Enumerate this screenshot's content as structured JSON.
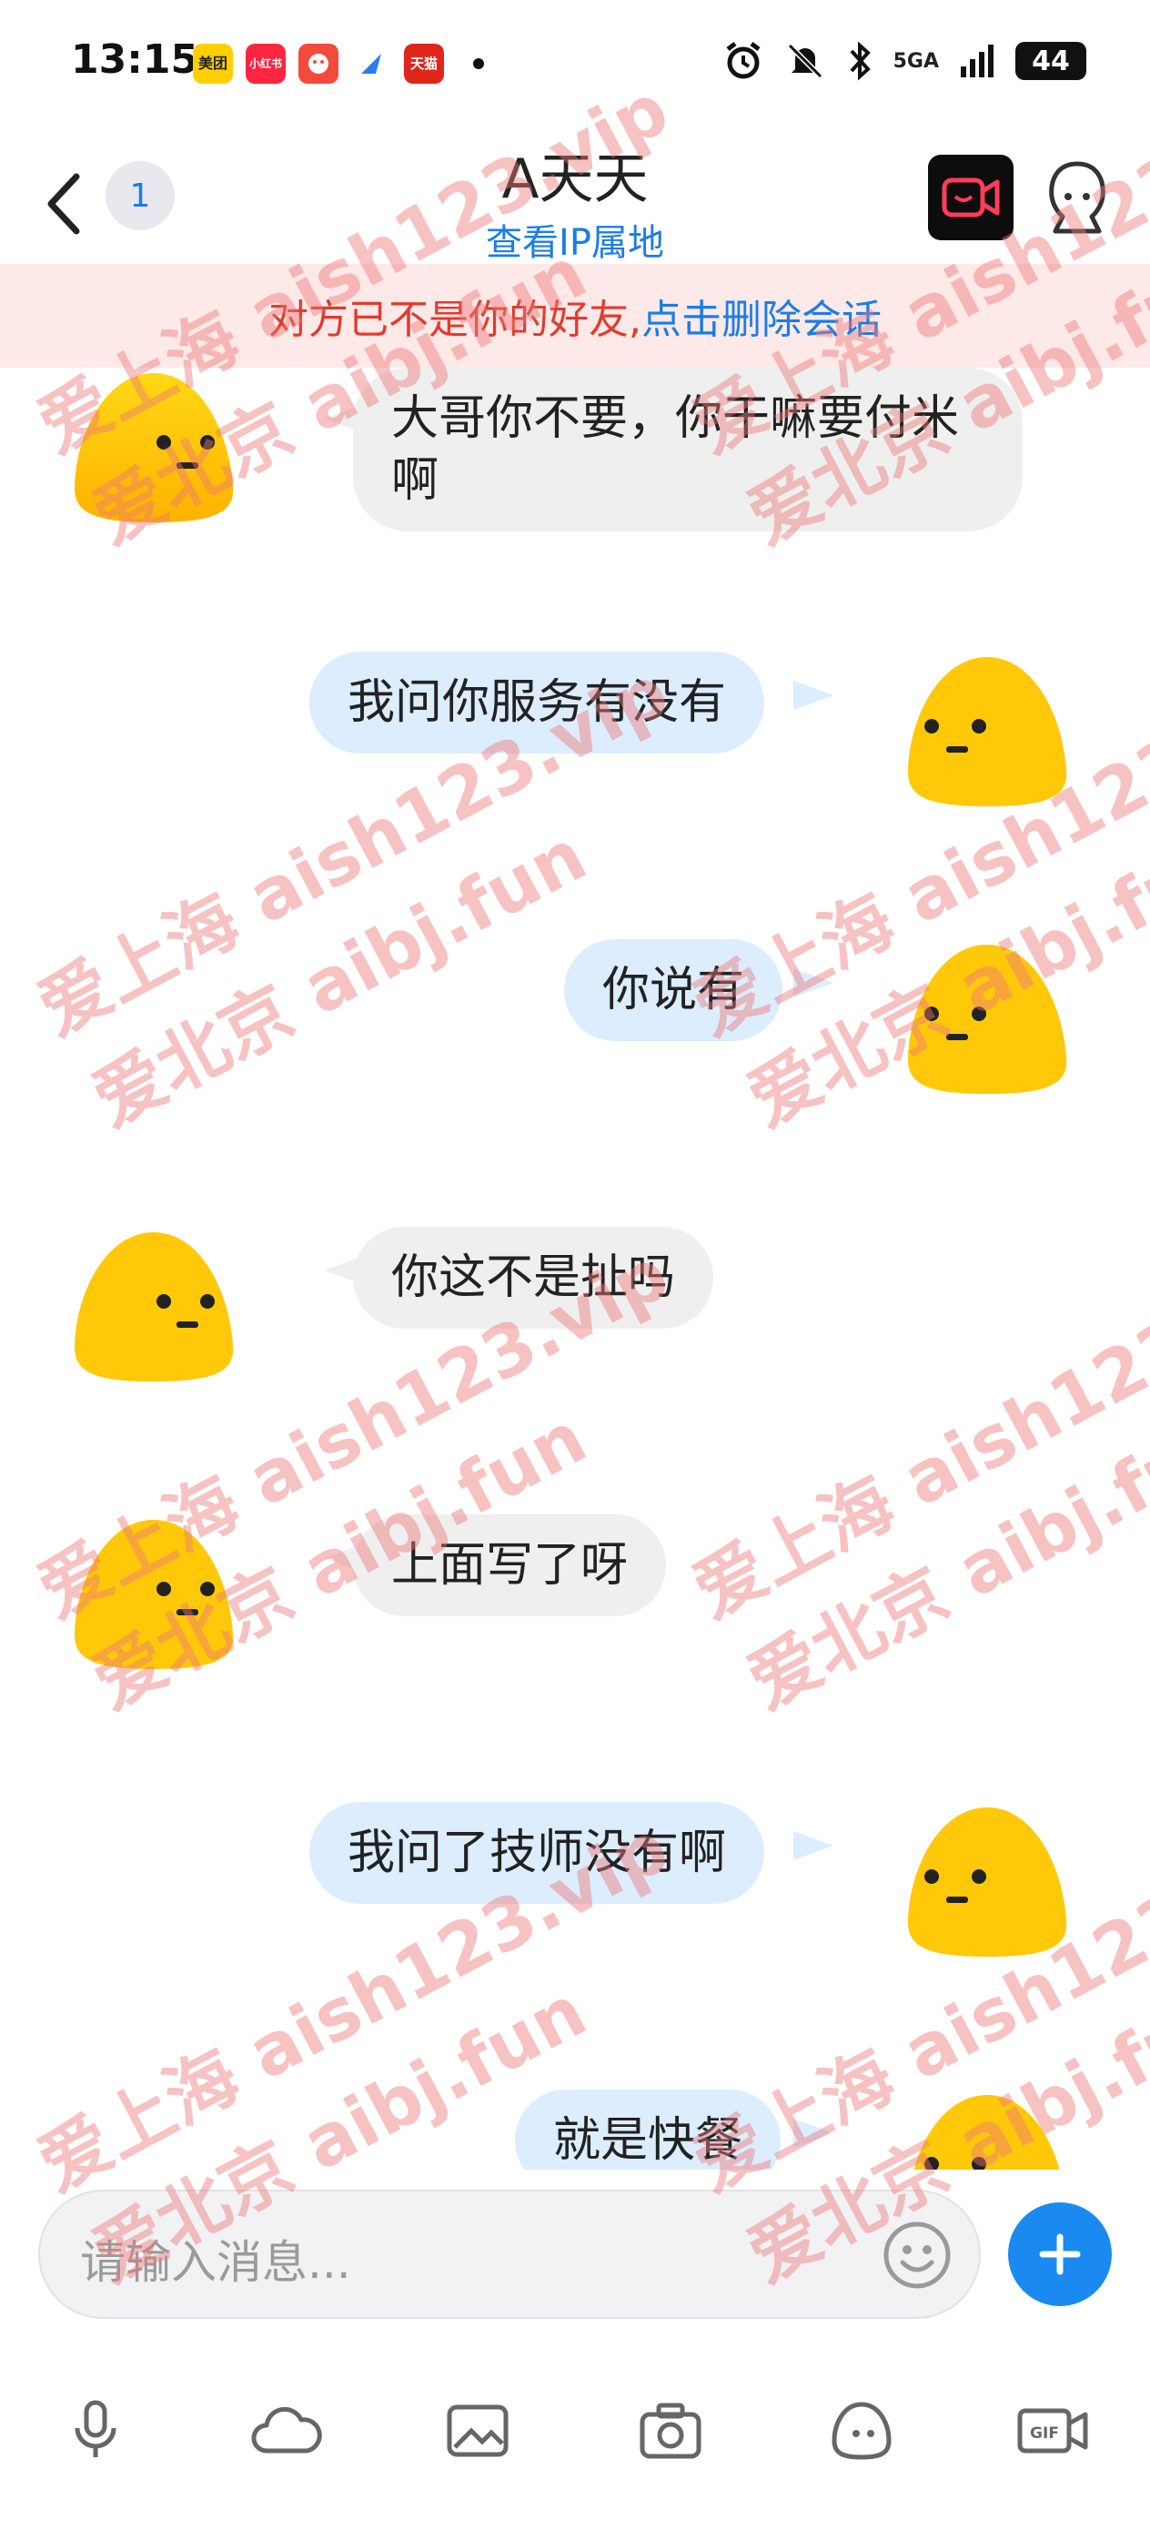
{
  "status_bar": {
    "time": "13:15",
    "apps": [
      {
        "label": "美团",
        "color": "#ffd000",
        "text_color": "#222"
      },
      {
        "label": "小红书",
        "color": "#ff2442",
        "text_color": "#fff"
      },
      {
        "label": "",
        "color": "#f34a3d",
        "text_color": "#fff"
      },
      {
        "label": "",
        "color": "#2a7ff0",
        "text_color": "#fff"
      },
      {
        "label": "天猫",
        "color": "#e1251b",
        "text_color": "#fff"
      }
    ],
    "network": "5GA",
    "battery": "44"
  },
  "header": {
    "unread_count": "1",
    "contact_name": "A天天",
    "ip_link": "查看IP属地"
  },
  "banner": {
    "notice": "对方已不是你的好友,",
    "action": "点击删除会话"
  },
  "messages": [
    {
      "side": "in",
      "text": "大哥你不要，你干嘛要付米啊"
    },
    {
      "side": "out",
      "text": "我问你服务有没有"
    },
    {
      "side": "out",
      "text": "你说有"
    },
    {
      "side": "in",
      "text": "你这不是扯吗"
    },
    {
      "side": "in",
      "text": "上面写了呀"
    },
    {
      "side": "out",
      "text": "我问了技师没有啊"
    },
    {
      "side": "out",
      "text": "就是快餐"
    }
  ],
  "input": {
    "placeholder": "请输入消息..."
  },
  "toolbar": {
    "icons": [
      "microphone-icon",
      "cloud-icon",
      "image-icon",
      "camera-icon",
      "sticker-icon",
      "gif-icon"
    ]
  },
  "watermark": {
    "line1": "爱上海 aish123.vip",
    "line2": "爱北京 aibj.fun"
  },
  "colors": {
    "accent": "#1a7de8",
    "warning": "#e23b2e",
    "bubble_in": "#efefef",
    "bubble_out": "#dcedfd"
  }
}
